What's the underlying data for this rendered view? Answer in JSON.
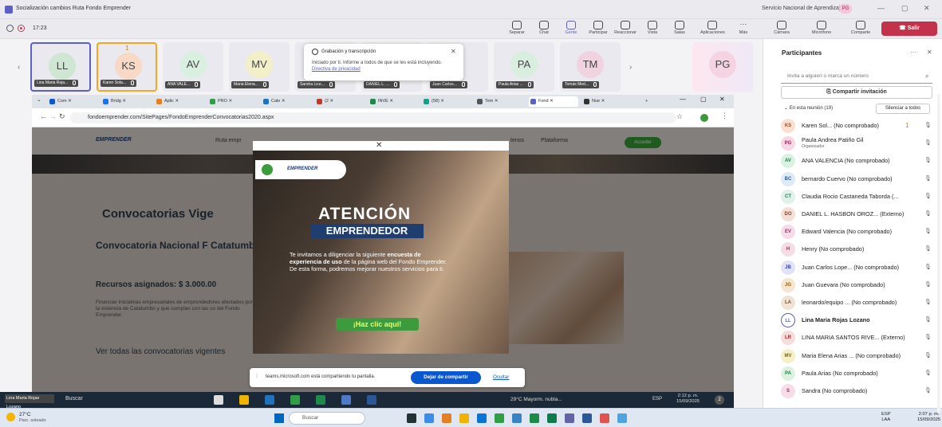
{
  "window": {
    "title": "Socialización cambios Ruta Fondo Emprender",
    "org": "Servicio Nacional de Aprendizaje",
    "org_badge": "PG",
    "ctl_min": "—",
    "ctl_max": "▢",
    "ctl_close": "✕"
  },
  "toolbar": {
    "timer": "17:23",
    "items": [
      "Separar",
      "Chat",
      "Gente",
      "Participar",
      "Reaccionar",
      "Vista",
      "Salas",
      "Aplicaciones",
      "Más",
      "Cámara",
      "Micrófono",
      "Comparte"
    ],
    "leave": "Salir",
    "active_color": "#5b5fc7"
  },
  "gallery": {
    "tiles": [
      {
        "initials": "LL",
        "name": "Lina Maria Roja...",
        "bg": "#cfe7d2"
      },
      {
        "initials": "KS",
        "name": "Karen Sola...",
        "bg": "#f7d9c6",
        "hand": "1"
      },
      {
        "initials": "AV",
        "name": "ANA VALE...",
        "bg": "#d9f0e1"
      },
      {
        "initials": "MV",
        "name": "Maria Elena...",
        "bg": "#f3efc8"
      },
      {
        "initials": "",
        "name": "Sandra Lice...",
        "bg": "#e2e2ea"
      },
      {
        "initials": "",
        "name": "DANIEL L. ...",
        "bg": "#e2e2ea"
      },
      {
        "initials": "",
        "name": "Juan Carlos...",
        "bg": "#e2e2ea"
      },
      {
        "initials": "PA",
        "name": "Paula Arias ...",
        "bg": "#d8efe0"
      },
      {
        "initials": "TM",
        "name": "Tomás Med...",
        "bg": "#f1d3df"
      },
      {
        "initials": "",
        "name": "",
        "bg": "#e2e2ea"
      },
      {
        "initials": "PG",
        "name": "",
        "bg": "#f6d3e2"
      }
    ]
  },
  "toast": {
    "title": "Grabación y transcripción",
    "body": "Iniciado por ti. Informe a todos de que se les está incluyendo.",
    "link": "Directiva de privacidad"
  },
  "browser": {
    "tabs": [
      "Com",
      "Bridg",
      "Aplic",
      "PRO",
      "Cale",
      "(2",
      "INVE",
      "(58)",
      "Tem",
      "Fond",
      "Nue"
    ],
    "url": "fondoemprender.com/SitePages/FondoEmprenderConvocatorias2020.aspx"
  },
  "site": {
    "logo": "EMPRENDER",
    "nav": [
      "Ruta empr",
      "tenos",
      "Plataforma"
    ],
    "nav_btn": "Acceder",
    "h1": "Convocatorias Vige",
    "h2": "Convocatoria Nacional F Catatumbo",
    "h3": "Recursos asignados: $ 3.000.00",
    "p": "Financiar iniciativas empresariales de emprendedores afectados por la violencia de Catatumbo y que cumplan con las co del Fondo Emprender.",
    "link": "Ver todas las convocatorias vigentes"
  },
  "popup": {
    "logo": "EMPRENDER",
    "h1": "ATENCIÓN",
    "h2": "EMPRENDEDOR",
    "body_pre": "Te invitamos a diligenciar la siguiente ",
    "body_bold": "encuesta de experiencia de uso",
    "body_post": " de la página web del Fondo Emprender. De esta forma, podremos mejorar nuestros servicios para ti.",
    "cta": "¡Haz clic aquí!"
  },
  "sharebar": {
    "text": "teams.microsoft.com está compartiendo tu pantalla.",
    "stop": "Dejar de compartir",
    "hide": "Ocultar"
  },
  "inner_taskbar": {
    "name": "Lina Maria Rojas Lozano",
    "search": "Buscar",
    "weather": "29°C Mayorm. nubla...",
    "lang": "ESP",
    "time": "2:12 p. m.",
    "date": "15/09/2025",
    "badge": "2"
  },
  "taskbar": {
    "temp": "27°C",
    "cond": "Parc. soleado",
    "search": "Buscar",
    "lang1": "ESP",
    "lang2": "LAA",
    "time": "2:07 p. m.",
    "date": "15/09/2025"
  },
  "panel": {
    "title": "Participantes",
    "more": "···",
    "close": "✕",
    "invite": "Invita a alguien o marca un número",
    "share": "Compartir invitación",
    "section": "En esta reunión (19)",
    "mute": "Silenciar a todos",
    "people": [
      {
        "ini": "KS",
        "name": "Karen Sol... (No comprobado)",
        "bg": "#f9e0d2",
        "fg": "#9a4a1f",
        "hand": "1"
      },
      {
        "ini": "PG",
        "name": "Paula Andrea Patiño Gil",
        "role": "Organizador",
        "bg": "#f7d7e6",
        "fg": "#a0245a"
      },
      {
        "ini": "AV",
        "name": "ANA VALENCIA (No comprobado)",
        "bg": "#dbf2e3",
        "fg": "#237b4b"
      },
      {
        "ini": "BC",
        "name": "bernardo Cuervo (No comprobado)",
        "bg": "#dfeaf7",
        "fg": "#1e5f9e"
      },
      {
        "ini": "CT",
        "name": "Claudia Rocio Castaneda Taborda (...",
        "bg": "#dff2ea",
        "fg": "#1e7a5a"
      },
      {
        "ini": "DO",
        "name": "DANIEL L. HASBON OROZ... (Externo)",
        "bg": "#f2e0d8",
        "fg": "#8a3e1e"
      },
      {
        "ini": "EV",
        "name": "Edward Valencia (No comprobado)",
        "bg": "#f6dcea",
        "fg": "#9d2a68"
      },
      {
        "ini": "H",
        "name": "Henry (No comprobado)",
        "bg": "#f5dde6",
        "fg": "#9e2a54"
      },
      {
        "ini": "JB",
        "name": "Juan Carlos Lope... (No comprobado)",
        "bg": "#e1e3f7",
        "fg": "#3a43a8"
      },
      {
        "ini": "JG",
        "name": "Juan Guevara (No comprobado)",
        "bg": "#f6e6cf",
        "fg": "#8c5a12"
      },
      {
        "ini": "LA",
        "name": "leonardo/equipo ... (No comprobado)",
        "bg": "#efe3d6",
        "fg": "#7a4f28"
      },
      {
        "ini": "LL",
        "name": "Lina Maria Rojas Lozano",
        "bg": "#fff",
        "fg": "#5b5fc7",
        "bold": true
      },
      {
        "ini": "LR",
        "name": "LINA MARIA SANTOS RIVE... (Externo)",
        "bg": "#f7dcdc",
        "fg": "#9d2a2a"
      },
      {
        "ini": "MV",
        "name": "Maria Elena Arias ... (No comprobado)",
        "bg": "#f5f0c8",
        "fg": "#7a6a10"
      },
      {
        "ini": "PA",
        "name": "Paula Arias (No comprobado)",
        "bg": "#dcf1e2",
        "fg": "#237b4b"
      },
      {
        "ini": "S",
        "name": "Sandra (No comprobado)",
        "bg": "#f7dcea",
        "fg": "#9d2a68"
      }
    ]
  }
}
